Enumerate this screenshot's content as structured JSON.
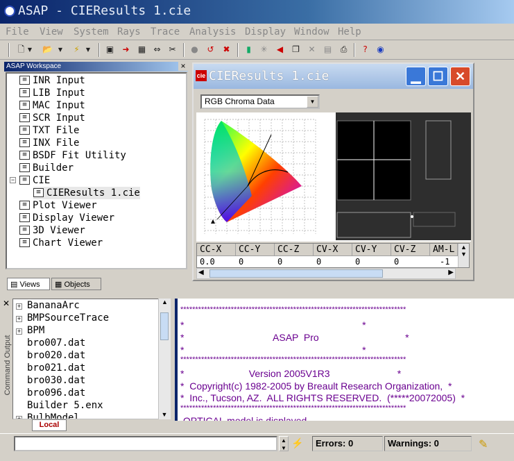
{
  "app": {
    "title": "ASAP - CIEResults 1.cie"
  },
  "menu": [
    "File",
    "View",
    "System",
    "Rays",
    "Trace",
    "Analysis",
    "Display",
    "Window",
    "Help"
  ],
  "toolbar_icons": [
    "new-file-icon",
    "open-folder-icon",
    "lightning-icon",
    "window-icon",
    "import-icon",
    "grid-icon",
    "move-icon",
    "trace-icon",
    "stop-icon",
    "undo-icon",
    "clear-icon",
    "chart-icon",
    "ray-icon",
    "back-icon",
    "copy-icon",
    "cut-icon",
    "layout-icon",
    "print-icon",
    "help-icon",
    "about-icon"
  ],
  "workspace": {
    "header": "ASAP Workspace",
    "close": "×",
    "items": [
      {
        "label": "INR Input",
        "depth": 0
      },
      {
        "label": "LIB Input",
        "depth": 0
      },
      {
        "label": "MAC Input",
        "depth": 0
      },
      {
        "label": "SCR Input",
        "depth": 0
      },
      {
        "label": "TXT File",
        "depth": 0
      },
      {
        "label": "INX File",
        "depth": 0
      },
      {
        "label": "BSDF Fit Utility",
        "depth": 0
      },
      {
        "label": "Builder",
        "depth": 0
      },
      {
        "label": "CIE",
        "depth": 0
      },
      {
        "label": "CIEResults 1.cie",
        "depth": 1
      },
      {
        "label": "Plot Viewer",
        "depth": 0
      },
      {
        "label": "Display Viewer",
        "depth": 0
      },
      {
        "label": "3D Viewer",
        "depth": 0
      },
      {
        "label": "Chart Viewer",
        "depth": 0
      }
    ],
    "tabs": [
      "Views",
      "Objects"
    ]
  },
  "cie_window": {
    "title": "CIEResults 1.cie",
    "icon_text": "cie",
    "select_value": "RGB Chroma Data",
    "columns": [
      "CC-X",
      "CC-Y",
      "CC-Z",
      "CV-X",
      "CV-Y",
      "CV-Z",
      "AM-L"
    ],
    "row": [
      "0.0",
      "0",
      "0",
      "0",
      "0",
      "0",
      "-1"
    ]
  },
  "files": [
    {
      "label": "BananaArc",
      "expandable": true
    },
    {
      "label": "BMPSourceTrace",
      "expandable": true
    },
    {
      "label": "BPM",
      "expandable": true
    },
    {
      "label": "bro007.dat",
      "expandable": false
    },
    {
      "label": "bro020.dat",
      "expandable": false
    },
    {
      "label": "bro021.dat",
      "expandable": false
    },
    {
      "label": "bro030.dat",
      "expandable": false
    },
    {
      "label": "bro096.dat",
      "expandable": false
    },
    {
      "label": "Builder 5.enx",
      "expandable": false
    },
    {
      "label": "BulbModel",
      "expandable": true
    }
  ],
  "command_output_label": "Command Output",
  "local_tab": "Local",
  "output_lines": [
    "****************************************************************************",
    "*                                                                  *",
    "*                                 ASAP  Pro                                *",
    "*                                                                  *",
    "****************************************************************************",
    "*                        Version 2005V1R3                         *",
    "*  Copyright(c) 1982-2005 by Breault Research Organization,  *",
    "*  Inc., Tucson, AZ.  ALL RIGHTS RESERVED.  (*****20072005)  *",
    "****************************************************************************",
    " OPTICAL model is displayed"
  ],
  "status": {
    "errors": "Errors: 0",
    "warnings": "Warnings: 0"
  }
}
